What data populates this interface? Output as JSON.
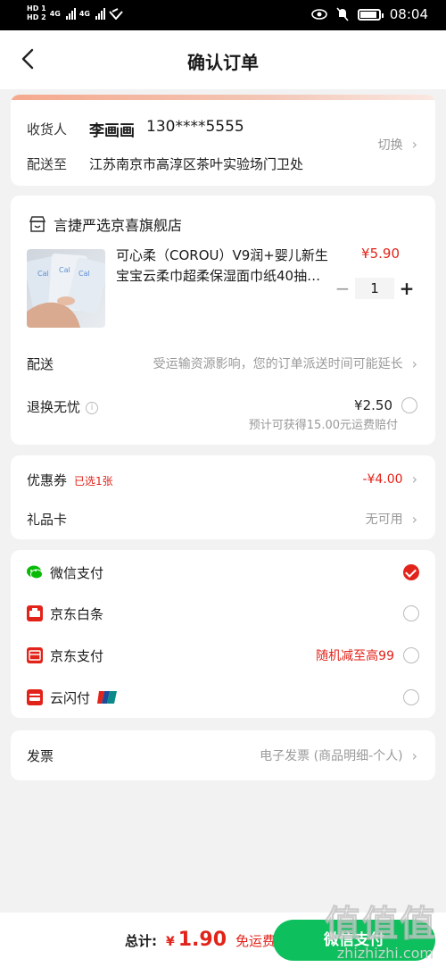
{
  "status_bar": {
    "hd1": "HD 1",
    "hd2": "HD 2",
    "net1": "4G",
    "net2": "4G",
    "time": "08:04"
  },
  "header": {
    "title": "确认订单"
  },
  "address": {
    "receiver_label": "收货人",
    "name": "李画画",
    "phone": "130****5555",
    "deliver_label": "配送至",
    "address": "江苏南京市高淳区茶叶实验场门卫处",
    "switch_label": "切换"
  },
  "shop": {
    "name": "言捷严选京喜旗舰店",
    "product": {
      "name": "可心柔（COROU）V9润+婴儿新生宝宝云柔巾超柔保湿面巾纸40抽…",
      "price": "¥5.90",
      "quantity": "1",
      "minus": "−",
      "plus": "+"
    },
    "delivery": {
      "label": "配送",
      "note": "受运输资源影响，您的订单派送时间可能延长"
    },
    "return_service": {
      "label": "退换无忧",
      "info": "i",
      "price": "¥2.50",
      "note": "预计可获得15.00元运费赔付"
    }
  },
  "coupon": {
    "label": "优惠券",
    "badge": "已选1张",
    "value": "-¥4.00"
  },
  "gift_card": {
    "label": "礼品卡",
    "value": "无可用"
  },
  "payment": {
    "methods": [
      {
        "name": "微信支付",
        "icon": "wechat-icon",
        "color": "#09bb07",
        "checked": true,
        "note": ""
      },
      {
        "name": "京东白条",
        "icon": "baitiao-icon",
        "color": "#e2231a",
        "checked": false,
        "note": ""
      },
      {
        "name": "京东支付",
        "icon": "jdpay-icon",
        "color": "#e2231a",
        "checked": false,
        "note": "随机减至高99"
      },
      {
        "name": "云闪付",
        "icon": "unionpay-icon",
        "color": "#e2231a",
        "checked": false,
        "note": ""
      }
    ]
  },
  "invoice": {
    "label": "发票",
    "value": "电子发票 (商品明细-个人)"
  },
  "bottom": {
    "total_label": "总计:",
    "currency": "¥",
    "amount": "1.90",
    "free_shipping": "免运费",
    "pay_button": "微信支付"
  },
  "watermark": {
    "text": "值值值",
    "sub": "zhizhizhi.com"
  },
  "colors": {
    "accent": "#e2231a",
    "pay_green": "#0dbf5d"
  }
}
